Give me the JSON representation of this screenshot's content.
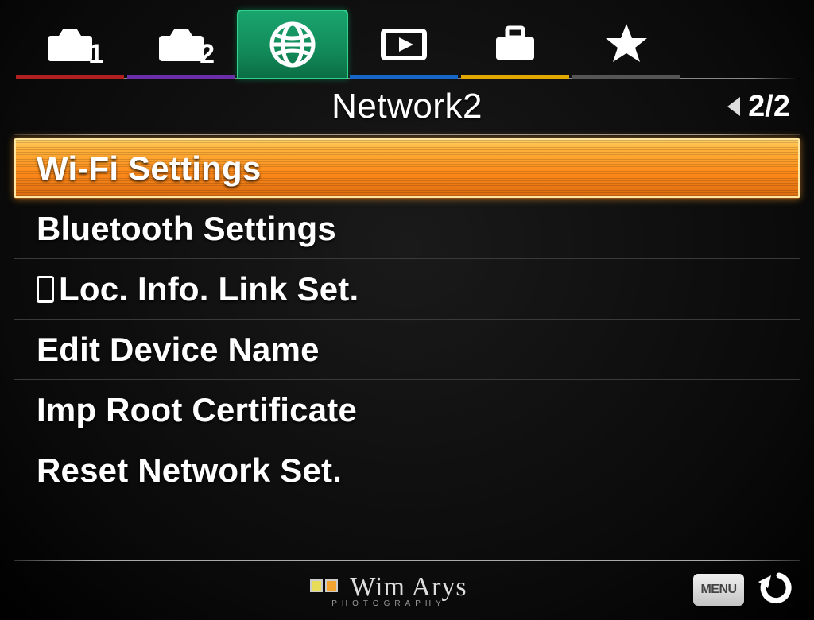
{
  "tabs": [
    {
      "name": "camera-1",
      "badge": "1"
    },
    {
      "name": "camera-2",
      "badge": "2"
    },
    {
      "name": "network",
      "active": true
    },
    {
      "name": "playback"
    },
    {
      "name": "setup"
    },
    {
      "name": "favorites"
    }
  ],
  "header": {
    "title": "Network2",
    "page_indicator": "2/2"
  },
  "menu": {
    "items": [
      {
        "label": "Wi-Fi Settings",
        "selected": true
      },
      {
        "label": "Bluetooth Settings",
        "selected": false
      },
      {
        "label": "Loc. Info. Link Set.",
        "selected": false,
        "prefix_icon": "phone-icon"
      },
      {
        "label": "Edit Device Name",
        "selected": false
      },
      {
        "label": "Imp Root Certificate",
        "selected": false
      },
      {
        "label": "Reset Network Set.",
        "selected": false
      }
    ]
  },
  "footer": {
    "menu_button": "MENU",
    "watermark": "Wim Arys",
    "watermark_sub": "PHOTOGRAPHY"
  }
}
